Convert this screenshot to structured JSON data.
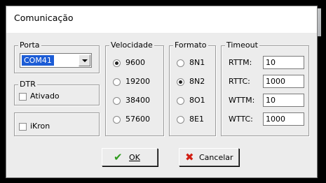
{
  "title": "Comunicação",
  "porta": {
    "legend": "Porta",
    "selected": "COM41"
  },
  "dtr": {
    "legend": "DTR",
    "checkbox_label": "Ativado"
  },
  "ikron": {
    "checkbox_label": "iKron"
  },
  "velocidade": {
    "legend": "Velocidade",
    "options": [
      "9600",
      "19200",
      "38400",
      "57600"
    ],
    "selected": "9600"
  },
  "formato": {
    "legend": "Formato",
    "options": [
      "8N1",
      "8N2",
      "8O1",
      "8E1"
    ],
    "selected": "8N2"
  },
  "timeout": {
    "legend": "Timeout",
    "fields": [
      {
        "label": "RTTM:",
        "value": "10"
      },
      {
        "label": "RTTC:",
        "value": "1000"
      },
      {
        "label": "WTTM:",
        "value": "10"
      },
      {
        "label": "WTTC:",
        "value": "1000"
      }
    ]
  },
  "buttons": {
    "ok": "OK",
    "cancel": "Cancelar"
  },
  "icons": {
    "ok": "check-icon",
    "cancel": "x-icon"
  },
  "colors": {
    "selection": "#1c5cd6",
    "ok_icon": "#2e9b1c",
    "cancel_icon": "#d11d12"
  }
}
